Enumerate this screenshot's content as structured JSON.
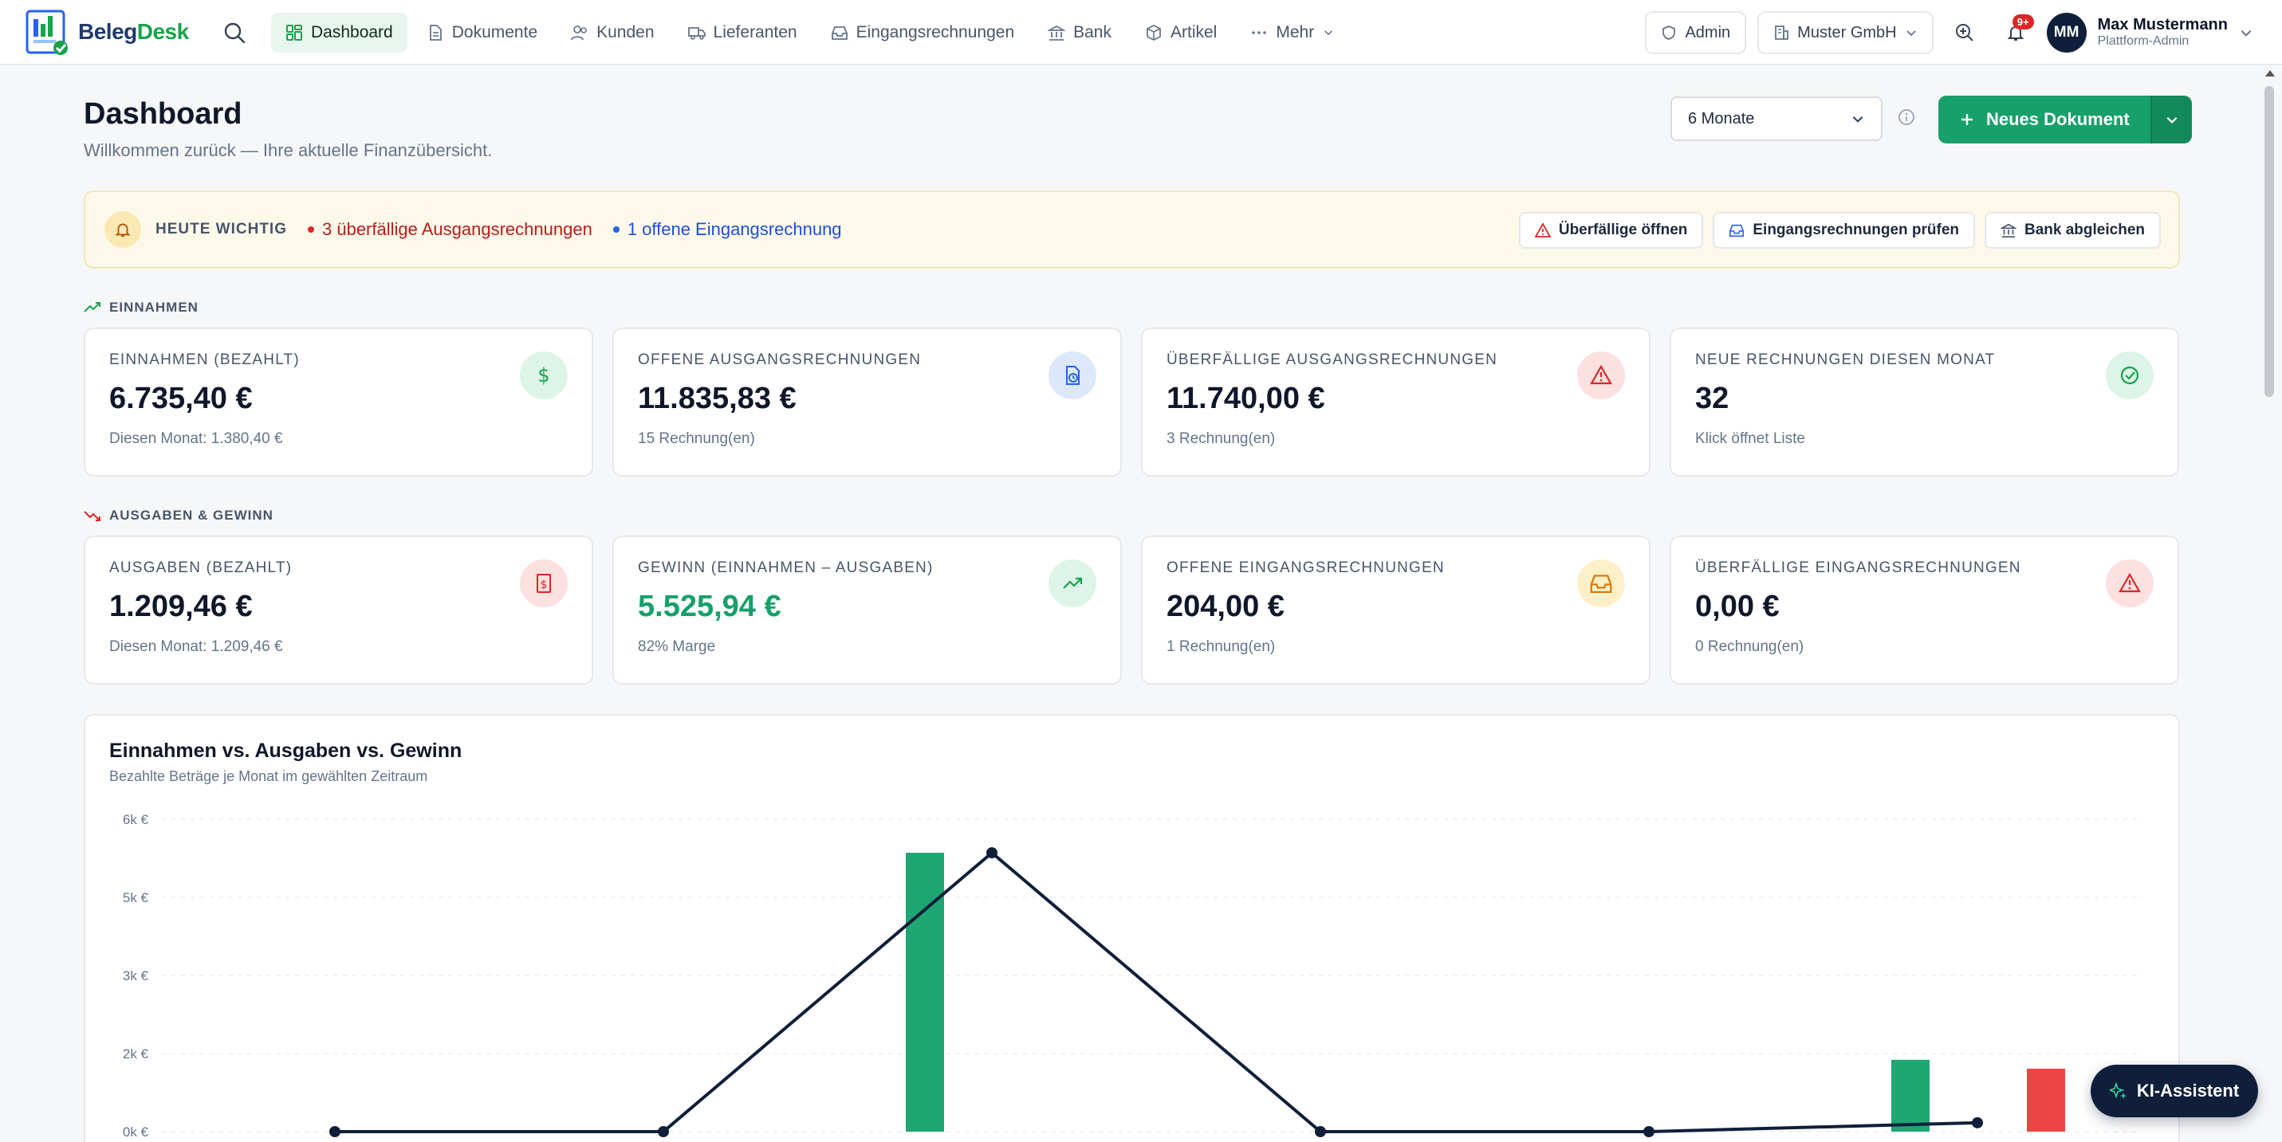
{
  "app": {
    "logo_a": "Beleg",
    "logo_b": "Desk"
  },
  "nav": {
    "items": [
      {
        "label": "Dashboard",
        "icon": "dashboard-icon"
      },
      {
        "label": "Dokumente",
        "icon": "document-icon"
      },
      {
        "label": "Kunden",
        "icon": "users-icon"
      },
      {
        "label": "Lieferanten",
        "icon": "truck-icon"
      },
      {
        "label": "Eingangsrechnungen",
        "icon": "inbox-icon"
      },
      {
        "label": "Bank",
        "icon": "bank-icon"
      },
      {
        "label": "Artikel",
        "icon": "box-icon"
      },
      {
        "label": "Mehr",
        "icon": "more-icon"
      }
    ],
    "admin_label": "Admin",
    "company": "Muster GmbH",
    "notifications": "9+",
    "user": {
      "initials": "MM",
      "name": "Max Mustermann",
      "role": "Plattform-Admin"
    }
  },
  "header": {
    "title": "Dashboard",
    "subtitle": "Willkommen zurück — Ihre aktuelle Finanzübersicht.",
    "period": "6 Monate",
    "new_doc": "Neues Dokument"
  },
  "today": {
    "label": "HEUTE WICHTIG",
    "overdue": "3 überfällige Ausgangsrechnungen",
    "open_incoming": "1 offene Eingangsrechnung",
    "actions": [
      "Überfällige öffnen",
      "Eingangsrechnungen prüfen",
      "Bank abgleichen"
    ]
  },
  "sections": {
    "income": "EINNAHMEN",
    "expenses": "AUSGABEN & GEWINN"
  },
  "cards_income": [
    {
      "title": "EINNAHMEN (BEZAHLT)",
      "value": "6.735,40 €",
      "sub": "Diesen Monat: 1.380,40 €",
      "icon": "dollar-icon"
    },
    {
      "title": "OFFENE AUSGANGSRECHNUNGEN",
      "value": "11.835,83 €",
      "sub": "15 Rechnung(en)",
      "icon": "file-clock-icon"
    },
    {
      "title": "ÜBERFÄLLIGE AUSGANGSRECHNUNGEN",
      "value": "11.740,00 €",
      "sub": "3 Rechnung(en)",
      "icon": "warning-icon"
    },
    {
      "title": "NEUE RECHNUNGEN DIESEN MONAT",
      "value": "32",
      "sub": "Klick öffnet Liste",
      "icon": "check-circle-icon"
    }
  ],
  "cards_expenses": [
    {
      "title": "AUSGABEN (BEZAHLT)",
      "value": "1.209,46 €",
      "sub": "Diesen Monat: 1.209,46 €",
      "icon": "receipt-icon"
    },
    {
      "title": "GEWINN (EINNAHMEN – AUSGABEN)",
      "value": "5.525,94 €",
      "sub": "82% Marge",
      "icon": "trend-up-icon"
    },
    {
      "title": "OFFENE EINGANGSRECHNUNGEN",
      "value": "204,00 €",
      "sub": "1 Rechnung(en)",
      "icon": "inbox-icon"
    },
    {
      "title": "ÜBERFÄLLIGE EINGANGSRECHNUNGEN",
      "value": "0,00 €",
      "sub": "0 Rechnung(en)",
      "icon": "warning-icon"
    }
  ],
  "chart": {
    "title": "Einnahmen vs. Ausgaben vs. Gewinn",
    "subtitle": "Bezahlte Beträge je Monat im gewählten Zeitraum"
  },
  "chart_data": {
    "type": "bar",
    "ytick_labels": [
      "0k €",
      "2k €",
      "3k €",
      "5k €",
      "6k €"
    ],
    "ytick_values": [
      0,
      1500,
      3000,
      4500,
      6000
    ],
    "ylim": [
      0,
      6000
    ],
    "series": [
      {
        "values": [
          0,
          0,
          5356,
          0,
          0,
          1380
        ],
        "color": "#1fa673"
      },
      {
        "values": [
          0,
          0,
          0,
          0,
          0,
          1209
        ],
        "color": "#ef4444"
      },
      {
        "values": [
          0,
          0,
          5356,
          0,
          0,
          171
        ],
        "color": "#0f1f3a"
      }
    ],
    "grid": true
  },
  "ki": {
    "label": "KI-Assistent"
  }
}
